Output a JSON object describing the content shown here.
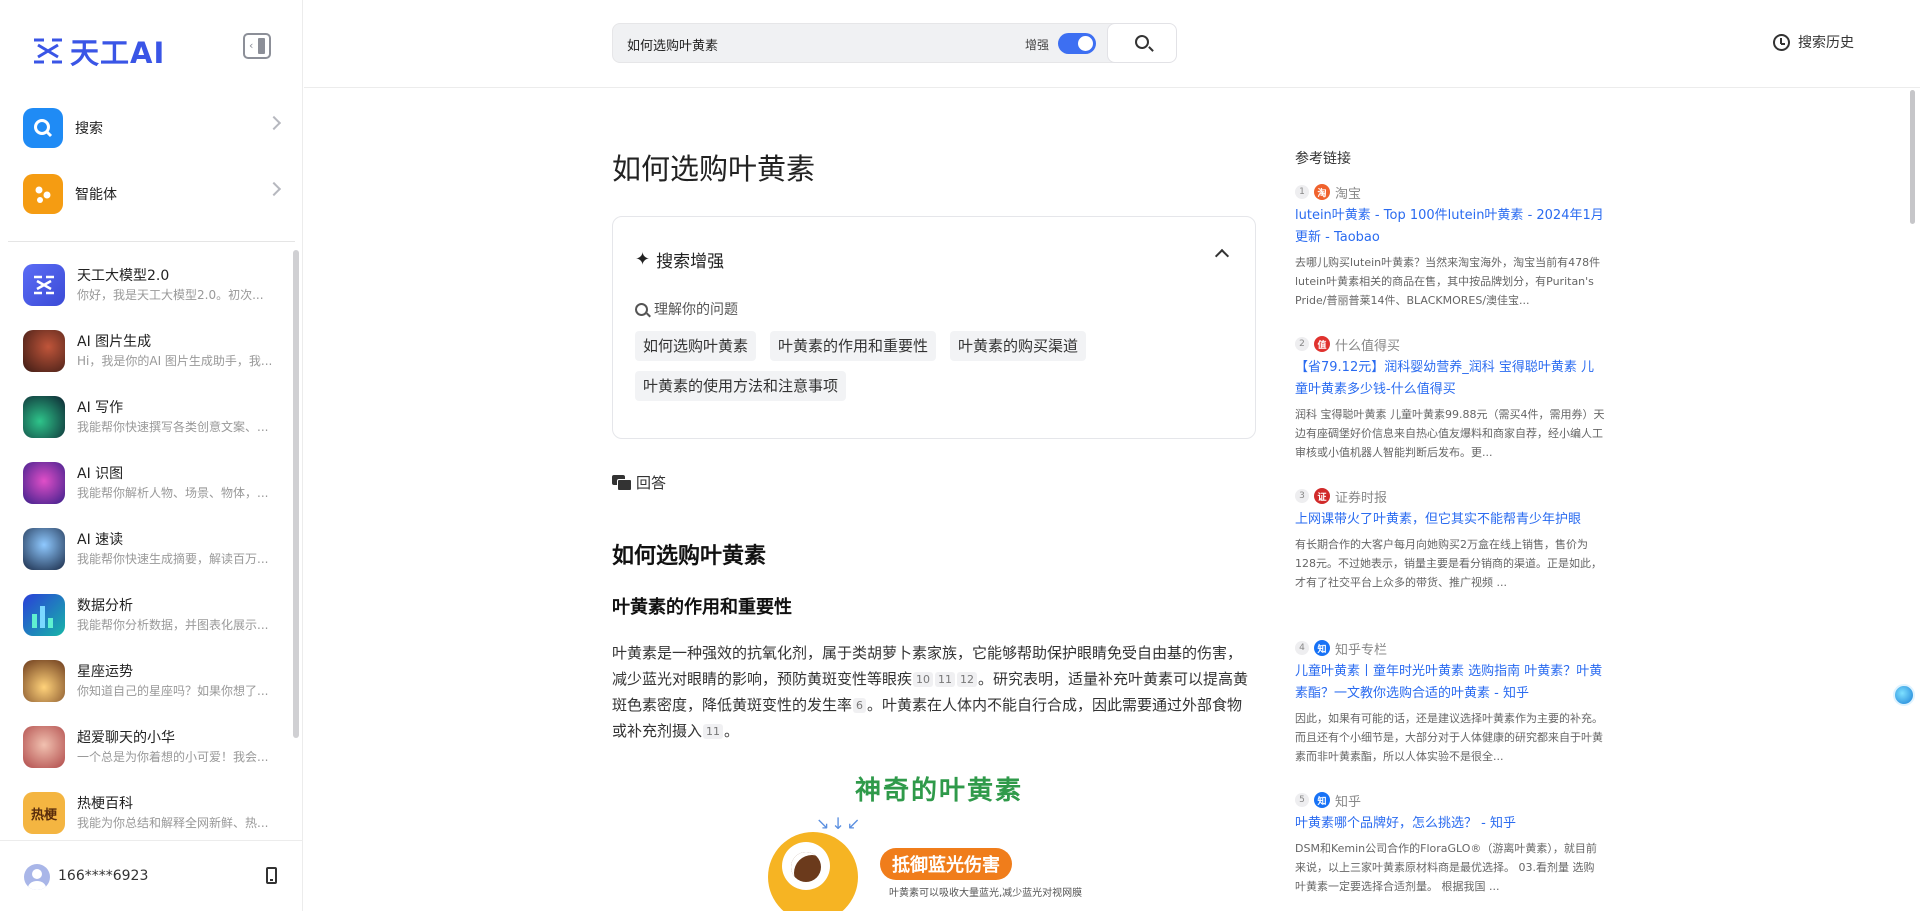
{
  "brand": {
    "name": "天工AI"
  },
  "sidebar": {
    "main_nav": [
      {
        "label": "搜索",
        "icon": "search-icon",
        "color": "#1f8bf5"
      },
      {
        "label": "智能体",
        "icon": "agent-icon",
        "color": "#f59c12"
      }
    ],
    "agents": [
      {
        "name": "天工大模型2.0",
        "desc": "你好，我是天工大模型2.0。初次...",
        "color": "#4c5ef0"
      },
      {
        "name": "AI 图片生成",
        "desc": "Hi，我是你的AI 图片生成助手，我...",
        "color": "#7a3b2a"
      },
      {
        "name": "AI 写作",
        "desc": "我能帮你快速撰写各类创意文案、...",
        "color": "#1d3f4f"
      },
      {
        "name": "AI 识图",
        "desc": "我能帮你解析人物、场景、物体，...",
        "color": "#7b3fd0"
      },
      {
        "name": "AI 速读",
        "desc": "我能帮你快速生成摘要，解读百万...",
        "color": "#26415e"
      },
      {
        "name": "数据分析",
        "desc": "我能帮你分析数据，并图表化展示...",
        "color": "#1c7f8f"
      },
      {
        "name": "星座运势",
        "desc": "你知道自己的星座吗？如果你想了...",
        "color": "#c46a2a"
      },
      {
        "name": "超爱聊天的小华",
        "desc": "一个总是为你着想的小可爱！我会...",
        "color": "#c7646a"
      },
      {
        "name": "热梗百科",
        "desc": "我能为你总结和解释全网新鲜、热...",
        "color": "#e8a53a",
        "badge": "热梗"
      }
    ],
    "user": {
      "name": "166****6923"
    }
  },
  "topbar": {
    "search_value": "如何选购叶黄素",
    "enhance_label": "增强",
    "history_label": "搜索历史"
  },
  "main": {
    "title": "如何选购叶黄素",
    "enhance": {
      "heading": "搜索增强",
      "understand_label": "理解你的问题",
      "chips": [
        "如何选购叶黄素",
        "叶黄素的作用和重要性",
        "叶黄素的购买渠道",
        "叶黄素的使用方法和注意事项"
      ]
    },
    "answer_label": "回答",
    "answer_h2": "如何选购叶黄素",
    "answer_h3": "叶黄素的作用和重要性",
    "answer_p": {
      "part1": "叶黄素是一种强效的抗氧化剂，属于类胡萝卜素家族，它能够帮助保护眼睛免受自由基的伤害，减少蓝光对眼睛的影响，预防黄斑变性等眼疾",
      "cites1": [
        "10",
        "11",
        "12"
      ],
      "part2": "。研究表明，适量补充叶黄素可以提高黄斑色素密度，降低黄斑变性的发生率",
      "cite2": "6",
      "part3": "。叶黄素在人体内不能自行合成，因此需要通过外部食物或补充剂摄入",
      "cite3": "11",
      "part4": "。"
    },
    "infographic": {
      "title": "神奇的叶黄素",
      "badge": "抵御蓝光伤害",
      "caption": "叶黄素可以吸收大量蓝光,减少蓝光对视网膜"
    }
  },
  "references": {
    "title": "参考链接",
    "items": [
      {
        "num": "1",
        "source": "淘宝",
        "logo_char": "淘",
        "logo_color": "#f0622d",
        "title": "lutein叶黄素 - Top 100件lutein叶黄素 - 2024年1月更新 - Taobao",
        "desc": "去哪儿购买lutein叶黄素？当然来淘宝海外，淘宝当前有478件lutein叶黄素相关的商品在售，其中按品牌划分，有Puritan's Pride/普丽普莱14件、BLACKMORES/澳佳宝..."
      },
      {
        "num": "2",
        "source": "什么值得买",
        "logo_char": "值",
        "logo_color": "#e0322e",
        "title": "【省79.12元】润科婴幼营养_润科 宝得聪叶黄素 儿童叶黄素多少钱-什么值得买",
        "desc": "润科 宝得聪叶黄素 儿童叶黄素99.88元（需买4件，需用券）天边有座碉堡好价信息来自热心值友爆料和商家自荐，经小编人工审核或小值机器人智能判断后发布。更..."
      },
      {
        "num": "3",
        "source": "证券时报",
        "logo_char": "证",
        "logo_color": "#d12a2a",
        "title": "上网课带火了叶黄素，但它其实不能帮青少年护眼",
        "desc": "有长期合作的大客户每月向她购买2万盒在线上销售，售价为128元。不过她表示，销量主要是看分销商的渠道。正是如此，才有了社交平台上众多的带货、推广视频 ..."
      },
      {
        "num": "4",
        "source": "知乎专栏",
        "logo_char": "知",
        "logo_color": "#1772f6",
        "title": "儿童叶黄素丨童年时光叶黄素 选购指南 叶黄素？叶黄素酯？一文教你选购合适的叶黄素 - 知乎",
        "desc": "因此，如果有可能的话，还是建议选择叶黄素作为主要的补充。 而且还有个小细节是，大部分对于人体健康的研究都来自于叶黄素而非叶黄素酯，所以人体实验不是很全..."
      },
      {
        "num": "5",
        "source": "知乎",
        "logo_char": "知",
        "logo_color": "#1772f6",
        "title": "叶黄素哪个品牌好，怎么挑选？ - 知乎",
        "desc": "DSM和Kemin公司合作的FloraGLO®（游离叶黄素），就目前来说，以上三家叶黄素原材料商是最优选择。 03.看剂量 选购叶黄素一定要选择合适剂量。 根据我国 ..."
      }
    ]
  },
  "colors": {
    "accent": "#3d6ff2",
    "link": "#2a6bf0",
    "brand": "#3a55e6"
  }
}
